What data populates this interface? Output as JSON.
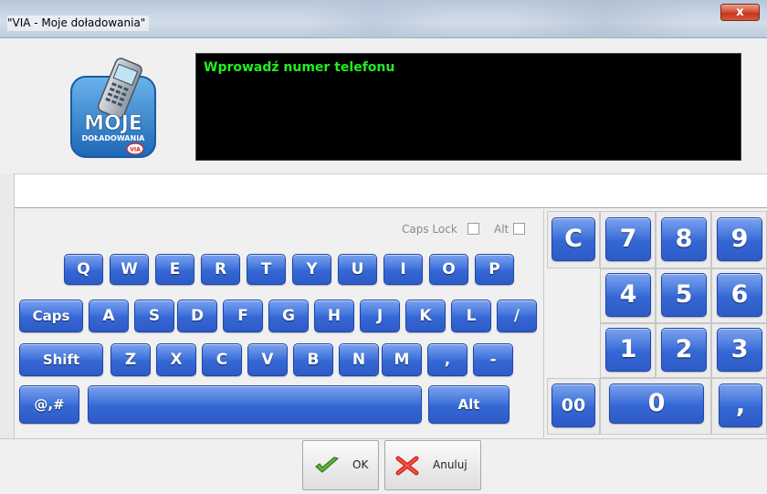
{
  "window": {
    "title": "\"VIA - Moje doładowania\"",
    "close_symbol": "x"
  },
  "logo": {
    "line1": "MOJE",
    "line2": "DOŁADOWANIA",
    "badge": "VIA"
  },
  "display": {
    "prompt": "Wprowadź numer telefonu",
    "text_color": "#22ee22"
  },
  "input": {
    "value": "",
    "placeholder": ""
  },
  "options": {
    "caps_lock_label": "Caps Lock",
    "caps_lock_checked": false,
    "alt_label": "Alt",
    "alt_checked": false
  },
  "keyboard": {
    "row1": [
      "Q",
      "W",
      "E",
      "R",
      "T",
      "Y",
      "U",
      "I",
      "O",
      "P"
    ],
    "row2": [
      "A",
      "S",
      "D",
      "F",
      "G",
      "H",
      "J",
      "K",
      "L",
      "/"
    ],
    "row3": [
      "Z",
      "X",
      "C",
      "V",
      "B",
      "N",
      "M",
      ",",
      "-"
    ],
    "caps_label": "Caps",
    "shift_label": "Shift",
    "symbols_label": "@,#",
    "space_label": "",
    "alt_label": "Alt"
  },
  "numpad": {
    "clear": "C",
    "row1": [
      "7",
      "8",
      "9"
    ],
    "row2": [
      "4",
      "5",
      "6"
    ],
    "row3": [
      "1",
      "2",
      "3"
    ],
    "double_zero": "00",
    "zero": "0",
    "comma": ","
  },
  "footer": {
    "ok_label": "OK",
    "cancel_label": "Anuluj"
  },
  "colors": {
    "key_blue": "#3567d4",
    "display_bg": "#000000",
    "close_red": "#c4361c"
  }
}
